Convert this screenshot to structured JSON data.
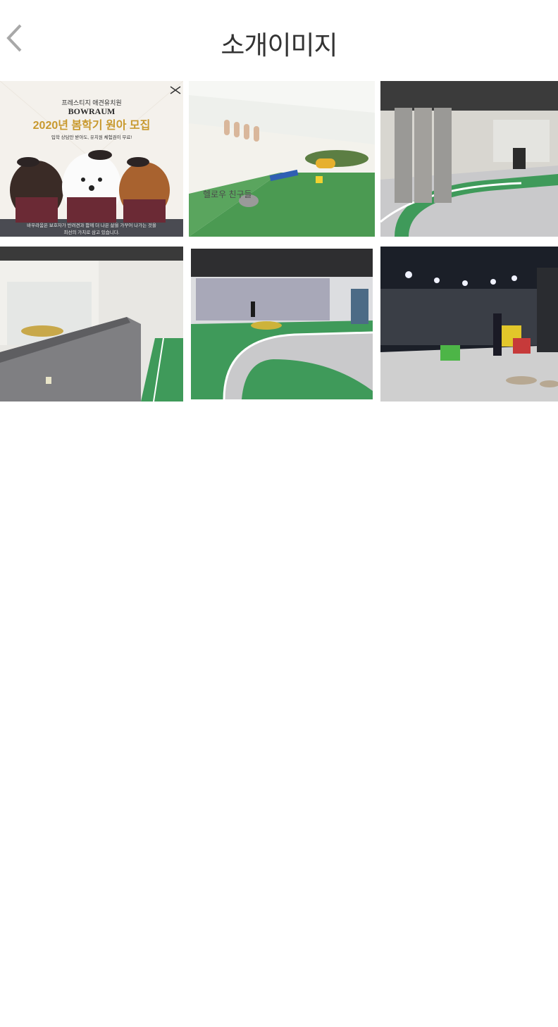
{
  "header": {
    "title": "소개이미지",
    "back_icon": "chevron-left-icon"
  },
  "gallery": {
    "images": [
      {
        "name": "promo-poster",
        "banner_small": "프레스티지 애견유치원",
        "brand": "BOWRAUM",
        "headline": "2020년 봄학기 원아 모집",
        "subline": "입학 상담만 받아도, 유치원 체험권이 무료!",
        "footer_line1": "바우라움은 보호자가 반려견과 함께 더 나은 삶을 가꾸어 나가는 것을",
        "footer_line2": "최선의 가치로 삼고 있습니다."
      },
      {
        "name": "playroom-photo",
        "wall_text": "헬로우 친구들"
      },
      {
        "name": "hallway-photo"
      },
      {
        "name": "counter-photo"
      },
      {
        "name": "track-photo"
      },
      {
        "name": "cafe-photo"
      }
    ]
  },
  "colors": {
    "track_green": "#3f9a5a",
    "floor_grey": "#c9c9cb",
    "title_text": "#333333",
    "poster_gold": "#c8992e"
  }
}
